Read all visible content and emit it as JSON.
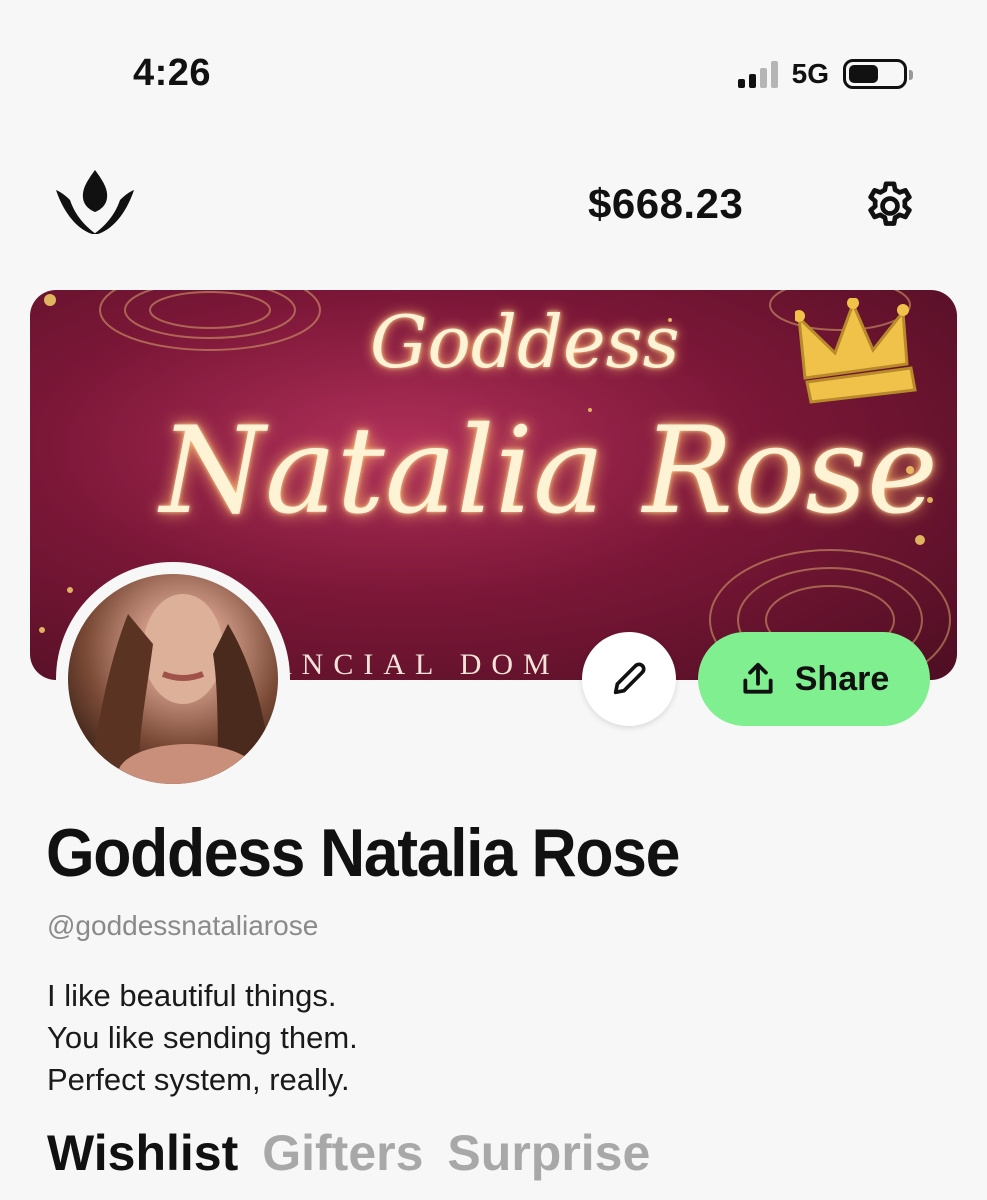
{
  "status_bar": {
    "time": "4:26",
    "network": "5G",
    "signal_bars_active": 2,
    "signal_bars_total": 4
  },
  "header": {
    "logo_icon": "crown-logo-icon",
    "balance": "$668.23",
    "settings_icon": "gear-icon"
  },
  "banner": {
    "line1": "Goddess",
    "line2": "Natalia Rose",
    "subtitle": "ANCIAL DOM",
    "crown_icon": "crown-icon"
  },
  "actions": {
    "edit_icon": "pencil-icon",
    "share_icon": "share-icon",
    "share_label": "Share"
  },
  "profile": {
    "name": "Goddess Natalia Rose",
    "handle": "@goddessnataliarose",
    "bio": [
      "I like beautiful things.",
      "You like sending them.",
      "Perfect system, really."
    ]
  },
  "tabs": [
    {
      "label": "Wishlist",
      "active": true
    },
    {
      "label": "Gifters",
      "active": false
    },
    {
      "label": "Surprise",
      "active": false
    }
  ],
  "colors": {
    "share_button": "#7fef8f",
    "banner_base": "#7c1738",
    "banner_text": "#fff3d6",
    "handle_text": "#8a8a8a",
    "inactive_tab": "#a8a8a8"
  }
}
